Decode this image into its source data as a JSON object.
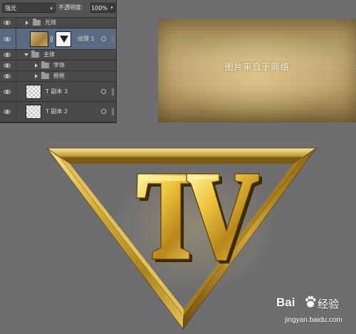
{
  "layers_panel": {
    "blend_mode": "强光",
    "opacity_label": "不透明度:",
    "opacity_value": "100%",
    "layers": [
      {
        "name": "光效",
        "kind": "group",
        "expanded": false,
        "visible": true
      },
      {
        "name": "纹理 1",
        "kind": "texture-with-mask",
        "selected": true,
        "visible": true
      },
      {
        "name": "主体",
        "kind": "group",
        "expanded": true,
        "visible": true
      },
      {
        "name": "字体",
        "kind": "group",
        "expanded": false,
        "visible": true
      },
      {
        "name": "框框",
        "kind": "group",
        "expanded": false,
        "visible": true
      },
      {
        "name": "T 副本 3",
        "kind": "text-layer",
        "visible": true,
        "has_fx": true
      },
      {
        "name": "T 副本 2",
        "kind": "text-layer",
        "visible": true,
        "has_fx": true
      }
    ]
  },
  "texture_preview": {
    "caption": "图片来自于网络"
  },
  "artwork": {
    "letters": "TV",
    "shape": "inverted-triangle",
    "material": "gold"
  },
  "watermark": {
    "brand": "Bai",
    "brand_suffix": "经验",
    "url": "jingyan.baidu.com"
  },
  "colors": {
    "canvas_bg": "#6e6d6f",
    "panel_bg": "#4a4a4a",
    "selected_row": "#5a6a80",
    "gold_light": "#f4dc7a",
    "gold_mid": "#c9a234",
    "gold_dark": "#6b4f12"
  },
  "icons": [
    "eye-icon",
    "folder-icon",
    "disclosure-triangle-icon",
    "link-icon",
    "fx-icon"
  ]
}
